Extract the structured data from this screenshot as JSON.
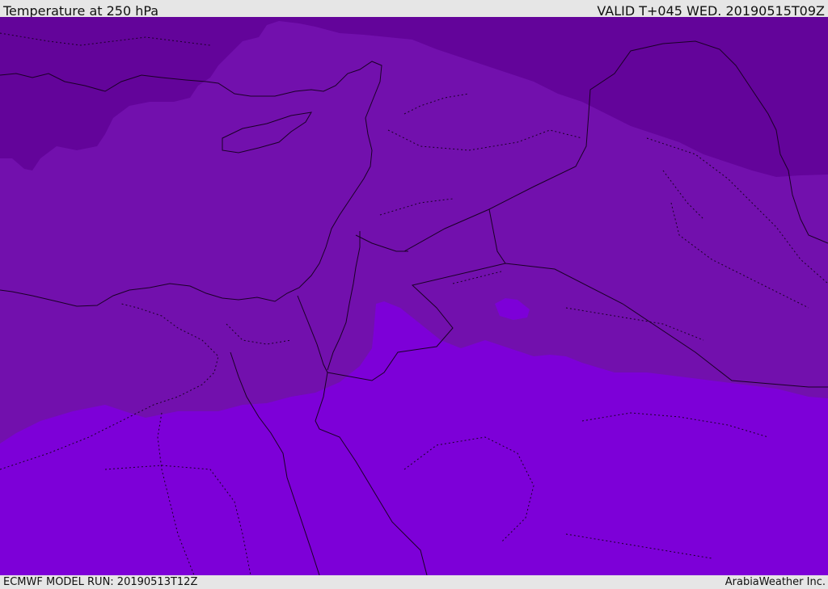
{
  "header": {
    "title": "Temperature at 250 hPa",
    "valid_time": "VALID T+045 WED. 20190515T09Z"
  },
  "footer": {
    "model_run": "ECMWF MODEL RUN: 20190513T12Z",
    "credit": "ArabiaWeather Inc."
  },
  "map": {
    "colors": {
      "cold_zone": "#63049a",
      "mid_zone": "#7210ad",
      "warm_zone": "#7d00d8",
      "coastline": "#1a0026",
      "border": "#1a0026"
    }
  }
}
